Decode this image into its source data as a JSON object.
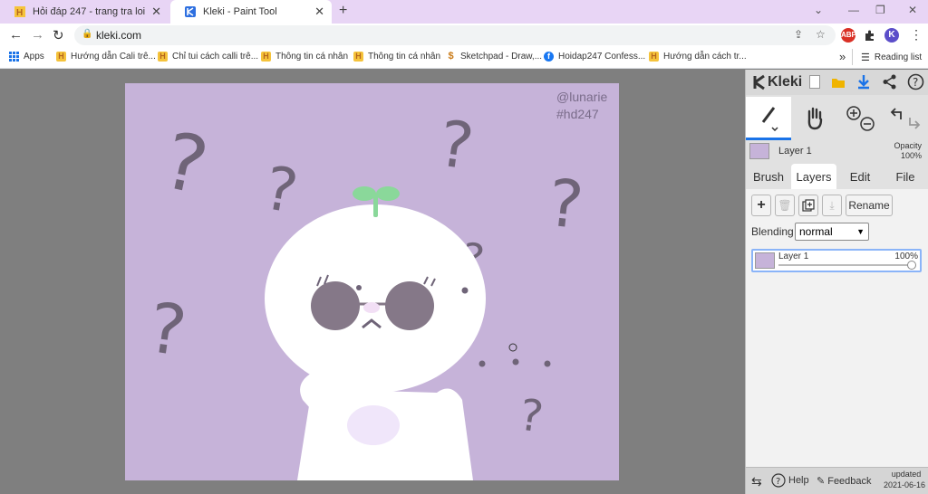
{
  "browser": {
    "tabs": [
      {
        "title": "Hỏi đáp 247 - trang tra loi",
        "active": false
      },
      {
        "title": "Kleki - Paint Tool",
        "active": true
      }
    ],
    "new_tab": "+",
    "window_controls": {
      "dropdown": "⌄",
      "minimize": "—",
      "restore": "❐",
      "close": "✕"
    },
    "url": "kleki.com",
    "profile_initial": "K",
    "abp_label": "ABP",
    "bookmarks": [
      {
        "label": "Apps",
        "icon": "apps-grid-icon"
      },
      {
        "label": "Hướng dẫn Cali trê...",
        "icon": "h-favicon"
      },
      {
        "label": "Chỉ tui cách calli trê...",
        "icon": "h-favicon"
      },
      {
        "label": "Thông tin cá nhân",
        "icon": "h-favicon"
      },
      {
        "label": "Thông tin cá nhân",
        "icon": "h-favicon"
      },
      {
        "label": "Sketchpad - Draw,...",
        "icon": "s-favicon"
      },
      {
        "label": "Hoidap247 Confess...",
        "icon": "facebook-icon"
      },
      {
        "label": "Hướng dẫn cách tr...",
        "icon": "h-favicon"
      }
    ],
    "bookmarks_more": "»",
    "reading_list": "Reading list"
  },
  "artwork": {
    "watermark_line1": "@lunarie",
    "watermark_line2": "#hd247",
    "question_mark": "?"
  },
  "kleki": {
    "logo_text": "Kleki",
    "layer_name": "Layer 1",
    "opacity_label": "Opacity",
    "opacity_value": "100%",
    "tabs": [
      "Brush",
      "Layers",
      "Edit",
      "File"
    ],
    "active_tab": "Layers",
    "buttons": {
      "add": "+",
      "rename": "Rename"
    },
    "blending_label": "Blending",
    "blending_value": "normal",
    "layer_item": {
      "name": "Layer 1",
      "opacity": "100%"
    },
    "help_label": "Help",
    "feedback_label": "Feedback",
    "updated_label": "updated",
    "updated_date": "2021-06-16",
    "colors": {
      "canvas_bg": "#c6b3d9",
      "accent": "#1a73e8"
    }
  }
}
